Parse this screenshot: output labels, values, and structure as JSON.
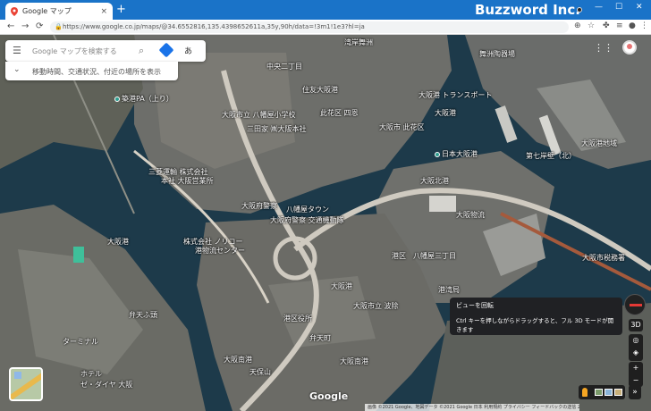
{
  "browser": {
    "tab_title": "Google マップ",
    "tab_close": "×",
    "new_tab": "+",
    "brand": "Buzzword Inc.",
    "window_controls": [
      "—",
      "☐",
      "✕"
    ],
    "url": "https://www.google.co.jp/maps/@34.6552816,135.4398652611a,35y,90h/data=!3m1!1e3?hl=ja",
    "nav": {
      "back": "←",
      "forward": "→",
      "reload": "⟳"
    }
  },
  "map": {
    "search_placeholder": "Google マップを検索する",
    "ime_label": "あ",
    "hint_text": "移動時間、交通状況、付近の場所を表示",
    "google_logo": "Google",
    "footer_text": "画像 ©2021 Google、地図データ ©2021 Google  日本  利用規約  プライバシー  フィードバックの送信  200 m",
    "tooltip": {
      "title": "ビューを回転",
      "body": "Ctrl キーを押しながらドラッグすると、フル 3D モードが開きます"
    },
    "controls": {
      "mode_3d": "3D",
      "zoom_in": "+",
      "zoom_out": "−",
      "expand": "»"
    },
    "labels": [
      "湾岸舞洲",
      "舞洲陶器場",
      "中央二丁目",
      "築港PA（上り）",
      "住友大阪港",
      "大阪市立 八幡屋小学校",
      "大阪港 トランスポート",
      "此花区 四恩",
      "三田家 ㈱大阪本社",
      "大阪港",
      "日本大阪港",
      "三菱運輸 株式会社",
      "本社 大阪営業所",
      "大阪港地域",
      "八幡屋タウン",
      "大阪府警察",
      "大阪府警察 交通機動隊",
      "株式会社 ノリコー",
      "港物流センター",
      "大阪物流",
      "大阪北港",
      "港区　八幡屋三丁目",
      "大阪市立 波除",
      "港区役所",
      "大阪港",
      "大阪南港",
      "弁天町",
      "第七岸壁（北）",
      "大阪市税務署",
      "ターミナル",
      "大阪港",
      "大阪南港",
      "天保山",
      "ホテル",
      "ゼ・ダイヤ 大阪",
      "弁天ふ頭",
      "大阪市 此花区",
      "港湾局"
    ]
  }
}
